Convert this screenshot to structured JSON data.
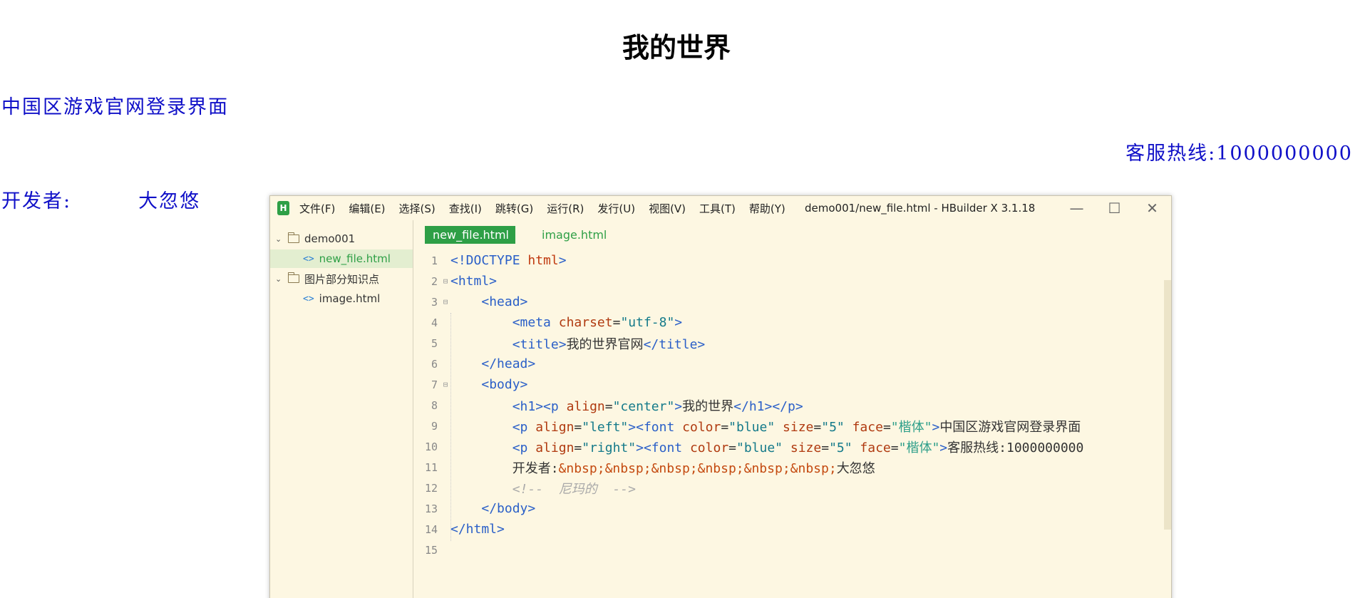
{
  "page": {
    "heading": "我的世界",
    "left_line": "中国区游戏官网登录界面",
    "right_line": "客服热线:1000000000",
    "dev_label": "开发者:",
    "dev_name": "大忽悠"
  },
  "window": {
    "logo": "H",
    "menu": [
      "文件(F)",
      "编辑(E)",
      "选择(S)",
      "查找(I)",
      "跳转(G)",
      "运行(R)",
      "发行(U)",
      "视图(V)",
      "工具(T)",
      "帮助(Y)"
    ],
    "title": "demo001/new_file.html - HBuilder X 3.1.18",
    "controls": {
      "minimize": "—",
      "maximize": "☐",
      "close": "✕"
    }
  },
  "sidebar": {
    "items": [
      {
        "label": "demo001",
        "type": "folder"
      },
      {
        "label": "new_file.html",
        "type": "file",
        "selected": true
      },
      {
        "label": "图片部分知识点",
        "type": "folder"
      },
      {
        "label": "image.html",
        "type": "file"
      }
    ],
    "file_icon": "<>"
  },
  "tabs": [
    {
      "label": "new_file.html",
      "active": true
    },
    {
      "label": "image.html",
      "active": false
    }
  ],
  "code": {
    "line_numbers": [
      "1",
      "2",
      "3",
      "4",
      "5",
      "6",
      "7",
      "8",
      "9",
      "10",
      "11",
      "12",
      "13",
      "14",
      "15"
    ],
    "l1": {
      "a": "<!DOCTYPE ",
      "b": "html",
      "c": ">"
    },
    "l2": "<html>",
    "l3": "<head>",
    "l4": {
      "a": "<meta ",
      "b": "charset",
      "c": "=",
      "d": "\"utf-8\"",
      "e": ">"
    },
    "l5": {
      "a": "<title>",
      "b": "我的世界官网",
      "c": "</title>"
    },
    "l6": "</head>",
    "l7": "<body>",
    "l8": {
      "a": "<h1><p ",
      "b": "align",
      "c": "=",
      "d": "\"center\"",
      "e": ">",
      "f": "我的世界",
      "g": "</h1></p>"
    },
    "l9": {
      "a": "<p ",
      "b": "align",
      "c": "=",
      "d": "\"left\"",
      "e": "><font ",
      "f": "color",
      "g": "=",
      "h": "\"blue\"",
      "i": " size",
      "j": "=",
      "k": "\"5\"",
      "l": " face",
      "m": "=",
      "n": "\"楷体\"",
      "o": ">",
      "p": "中国区游戏官网登录界面"
    },
    "l10": {
      "a": "<p ",
      "b": "align",
      "c": "=",
      "d": "\"right\"",
      "e": "><font ",
      "f": "color",
      "g": "=",
      "h": "\"blue\"",
      "i": " size",
      "j": "=",
      "k": "\"5\"",
      "l": " face",
      "m": "=",
      "n": "\"楷体\"",
      "o": ">",
      "p": "客服热线:1000000000"
    },
    "l11": {
      "a": "开发者:",
      "b": "&nbsp;&nbsp;&nbsp;&nbsp;&nbsp;&nbsp;",
      "c": "大忽悠"
    },
    "l12": "<!--  尼玛的  -->",
    "l13": "</body>",
    "l14": "</html>"
  }
}
